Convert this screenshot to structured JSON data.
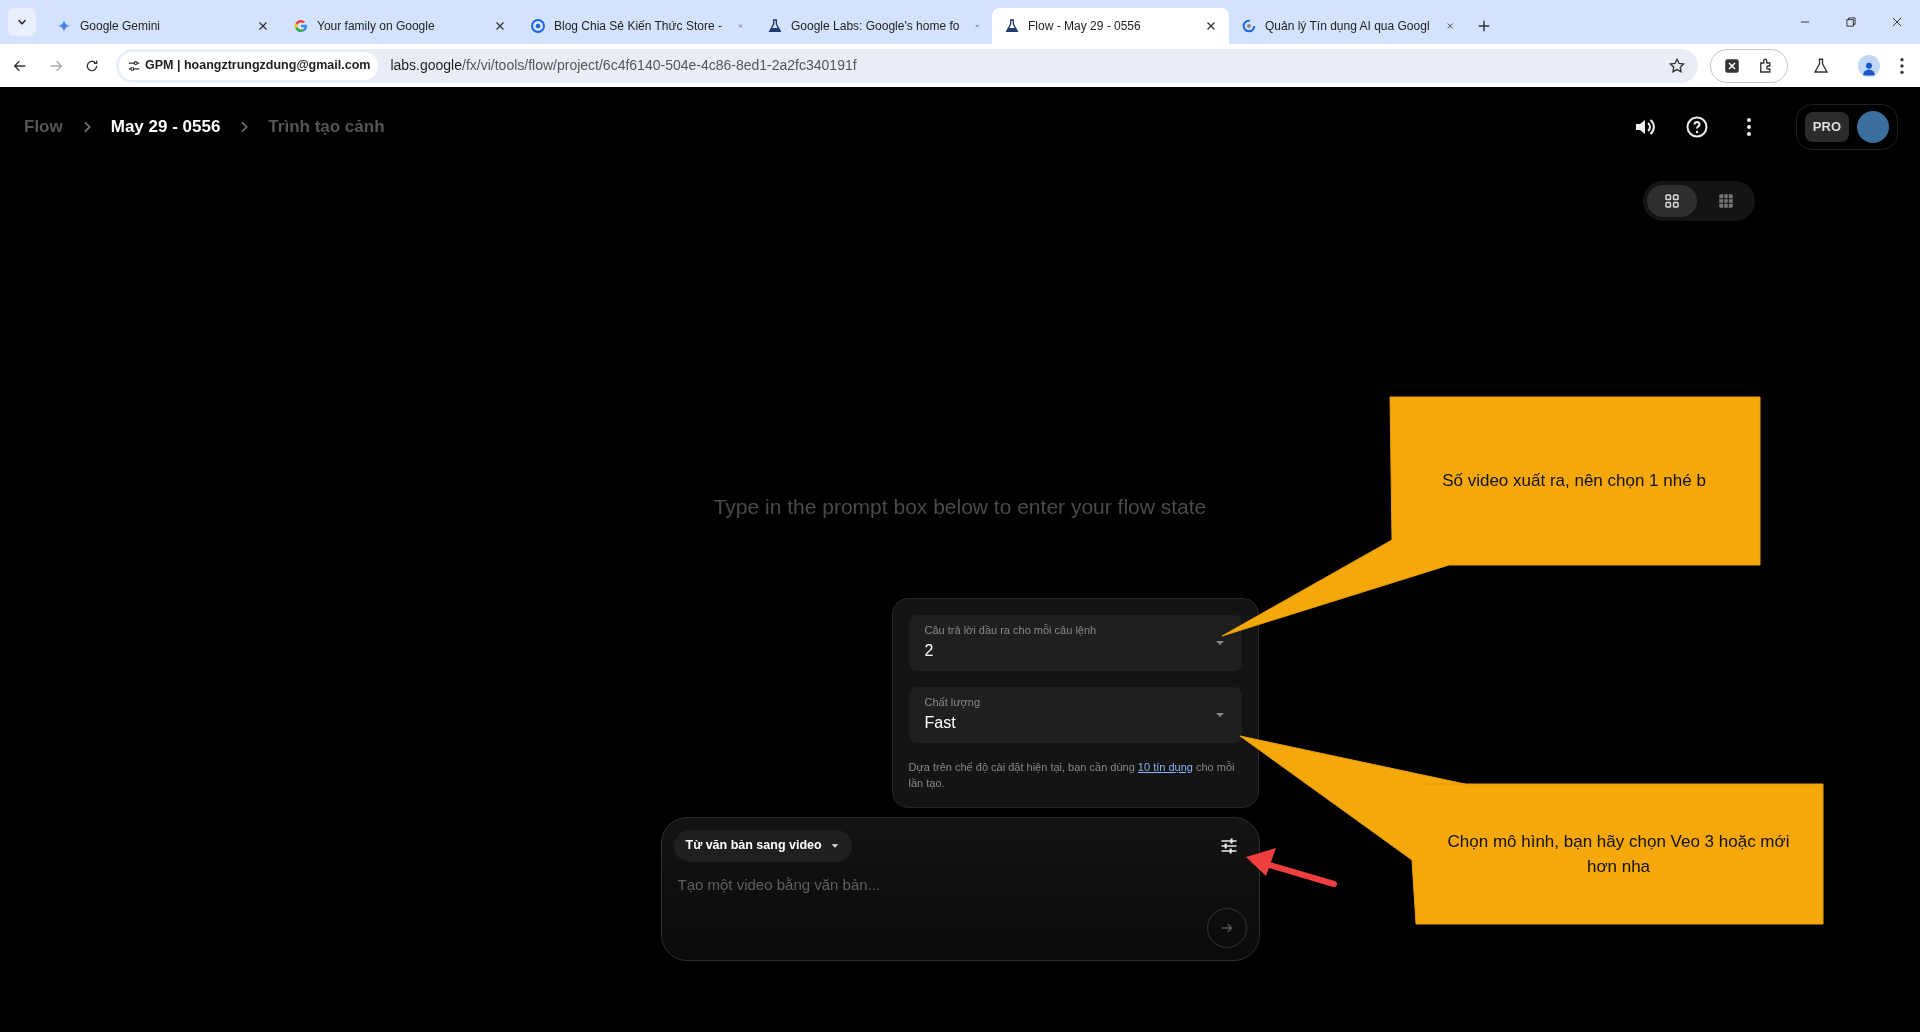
{
  "browser": {
    "tabs": [
      {
        "title": "Google Gemini",
        "selected": false
      },
      {
        "title": "Your family on Google",
        "selected": false
      },
      {
        "title": "Blog Chia Sẻ Kiến Thức Store -",
        "selected": false
      },
      {
        "title": "Google Labs: Google's home fo",
        "selected": false
      },
      {
        "title": "Flow - May 29 - 0556",
        "selected": true
      },
      {
        "title": "Quản lý Tín dụng AI qua Googl",
        "selected": false
      }
    ],
    "profile_chip": "GPM | hoangztrungzdung@gmail.com",
    "url_host": "labs.google",
    "url_path": "/fx/vi/tools/flow/project/6c4f6140-504e-4c86-8ed1-2a2fc340191f"
  },
  "breadcrumb": [
    {
      "label": "Flow",
      "selected": false
    },
    {
      "label": "May 29 - 0556",
      "selected": true
    },
    {
      "label": "Trình tạo cảnh",
      "selected": false
    }
  ],
  "plan_badge": "PRO",
  "view_toggle": [
    {
      "kind": "grid",
      "selected": true
    },
    {
      "kind": "table",
      "selected": false
    }
  ],
  "empty_message": "Type in the prompt box below to enter your flow state",
  "settings": {
    "fields": [
      {
        "label": "Câu trả lời đầu ra cho mỗi câu lệnh",
        "value": "2"
      },
      {
        "label": "Chất lượng",
        "value": "Fast"
      }
    ],
    "note": {
      "text_before": "Dựa trên chế độ cài đặt hiện tại, bạn cần dùng",
      "link": "10 tín dụng",
      "text_after": "cho mỗi lần tạo."
    }
  },
  "prompt": {
    "mode": "Từ văn bản sang video",
    "placeholder": "Tạo một video bằng văn bản..."
  },
  "callouts": [
    {
      "text": "Số video xuất ra, nên chọn 1 nhé b"
    },
    {
      "text": "Chọn mô hình, bạn hãy chọn Veo 3 hoặc mới hơn nha"
    }
  ]
}
